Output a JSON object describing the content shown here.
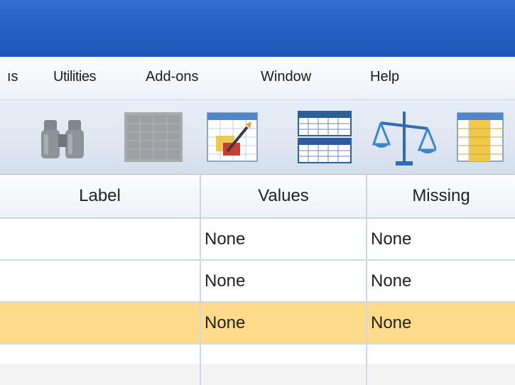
{
  "menubar": {
    "items": [
      {
        "label": "ıs"
      },
      {
        "label": "Utilities"
      },
      {
        "label": "Add-ons"
      },
      {
        "label": "Window"
      },
      {
        "label": "Help"
      }
    ]
  },
  "toolbar": {
    "icons": [
      "binoculars-icon",
      "grid-disabled-icon",
      "chart-builder-icon",
      "split-table-icon",
      "scale-weight-icon",
      "value-labels-icon"
    ]
  },
  "table": {
    "columns": [
      "Label",
      "Values",
      "Missing"
    ],
    "rows": [
      {
        "label": "",
        "values": "None",
        "missing": "None",
        "selected": false
      },
      {
        "label": "",
        "values": "None",
        "missing": "None",
        "selected": false
      },
      {
        "label": "",
        "values": "None",
        "missing": "None",
        "selected": true
      },
      {
        "label": "",
        "values": "",
        "missing": "",
        "selected": false
      }
    ]
  },
  "colors": {
    "titlebar": "#2563c6",
    "selected_row": "#fddb8a",
    "grid_line": "#c8daf0"
  }
}
